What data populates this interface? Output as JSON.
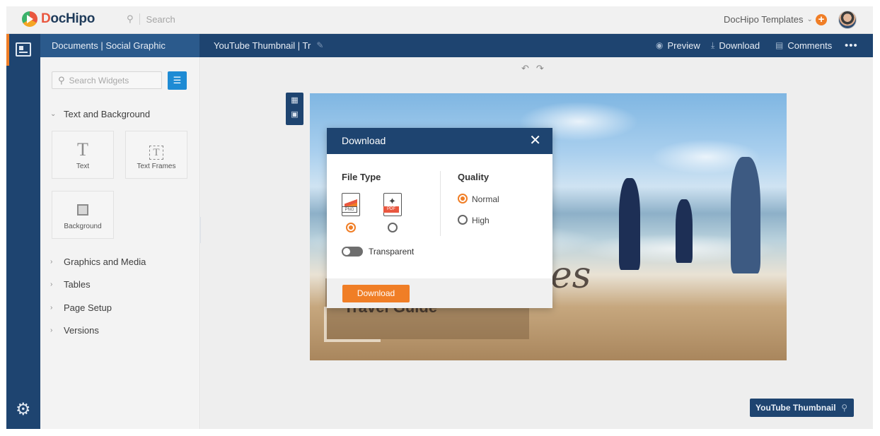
{
  "app": {
    "logo_text_d": "D",
    "logo_text_rest": "ocHipo",
    "search_placeholder": "Search",
    "templates_menu": "DocHipo Templates",
    "accent_color": "#f07e26",
    "brand_color": "#1e4470"
  },
  "header": {
    "breadcrumb": "Documents | Social Graphic",
    "doc_title": "YouTube Thumbnail | Tr",
    "preview": "Preview",
    "download": "Download",
    "comments": "Comments",
    "more": "•••"
  },
  "sidebar": {
    "search_placeholder": "Search Widgets",
    "sections": {
      "text_bg": "Text and Background",
      "graphics": "Graphics and Media",
      "tables": "Tables",
      "page_setup": "Page Setup",
      "versions": "Versions"
    },
    "tiles": {
      "text": "Text",
      "text_frames": "Text Frames",
      "background": "Background"
    }
  },
  "canvas": {
    "design_script": "es",
    "design_subtitle": "Travel Guide",
    "size_chip": "YouTube Thumbnail"
  },
  "modal": {
    "title": "Download",
    "file_type_label": "File Type",
    "quality_label": "Quality",
    "file_types": [
      "PNG",
      "PDF"
    ],
    "selected_file_type": "PNG",
    "quality_options": [
      "Normal",
      "High"
    ],
    "selected_quality": "Normal",
    "transparent_label": "Transparent",
    "transparent_enabled": false,
    "download_button": "Download"
  }
}
